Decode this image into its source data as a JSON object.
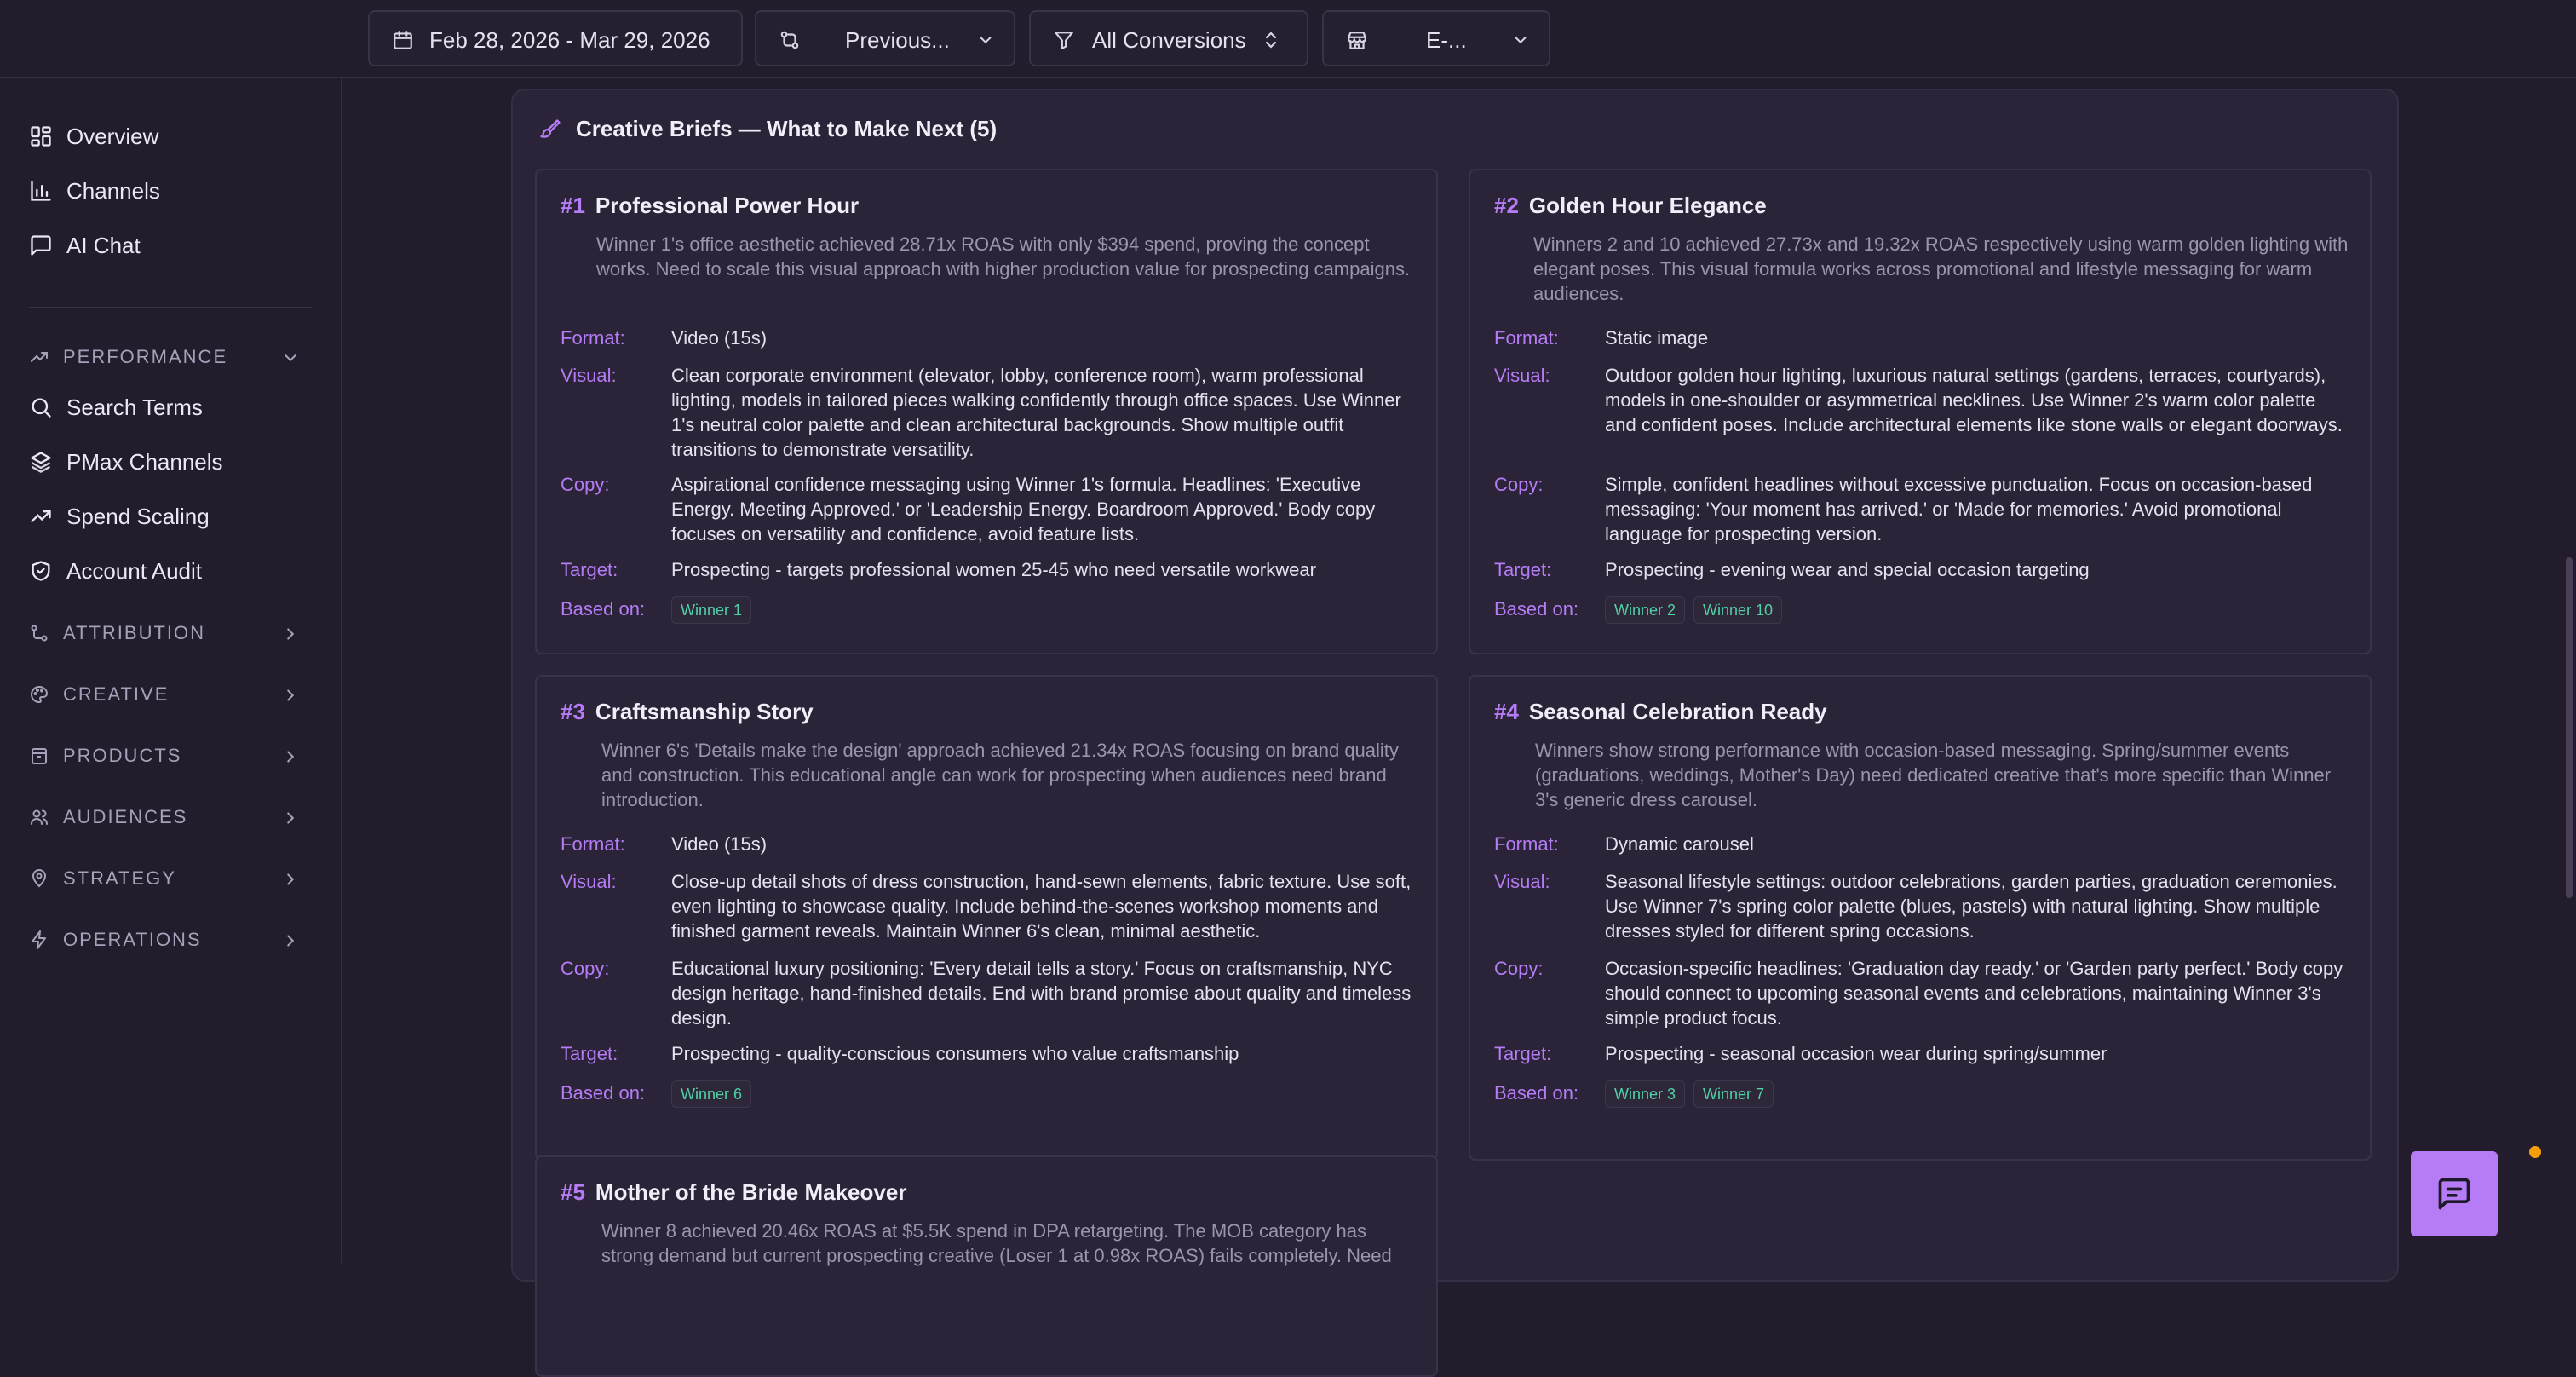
{
  "topbar": {
    "date_range": "Feb 28, 2026 - Mar 29, 2026",
    "compare": "Previous...",
    "conversions": "All Conversions",
    "store": "E-..."
  },
  "sidebar": {
    "main_items": [
      {
        "label": "Overview",
        "icon": "grid-icon"
      },
      {
        "label": "Channels",
        "icon": "bar-chart-icon"
      },
      {
        "label": "AI Chat",
        "icon": "chat-icon"
      }
    ],
    "performance_label": "PERFORMANCE",
    "performance_items": [
      {
        "label": "Search Terms",
        "icon": "search-icon"
      },
      {
        "label": "PMax Channels",
        "icon": "layers-icon"
      },
      {
        "label": "Spend Scaling",
        "icon": "trending-up-icon"
      },
      {
        "label": "Account Audit",
        "icon": "shield-check-icon"
      }
    ],
    "sections": [
      {
        "label": "ATTRIBUTION",
        "icon": "route-icon"
      },
      {
        "label": "CREATIVE",
        "icon": "palette-icon"
      },
      {
        "label": "PRODUCTS",
        "icon": "package-icon"
      },
      {
        "label": "AUDIENCES",
        "icon": "users-icon"
      },
      {
        "label": "STRATEGY",
        "icon": "map-pin-icon"
      },
      {
        "label": "OPERATIONS",
        "icon": "zap-icon"
      }
    ]
  },
  "panel": {
    "title": "Creative Briefs — What to Make Next (5)",
    "labels": {
      "format": "Format:",
      "visual": "Visual:",
      "copy": "Copy:",
      "target": "Target:",
      "based_on": "Based on:"
    },
    "cards": [
      {
        "num": "#1",
        "title": "Professional Power Hour",
        "desc": "Winner 1's office aesthetic achieved 28.71x ROAS with only $394 spend, proving the concept works. Need to scale this visual approach with higher production value for prospecting campaigns.",
        "format": "Video (15s)",
        "visual": "Clean corporate environment (elevator, lobby, conference room), warm professional lighting, models in tailored pieces walking confidently through office spaces. Use Winner 1's neutral color palette and clean architectural backgrounds. Show multiple outfit transitions to demonstrate versatility.",
        "copy": "Aspirational confidence messaging using Winner 1's formula. Headlines: 'Executive Energy. Meeting Approved.' or 'Leadership Energy. Boardroom Approved.' Body copy focuses on versatility and confidence, avoid feature lists.",
        "target": "Prospecting - targets professional women 25-45 who need versatile workwear",
        "based_on": [
          "Winner 1"
        ]
      },
      {
        "num": "#2",
        "title": "Golden Hour Elegance",
        "desc": "Winners 2 and 10 achieved 27.73x and 19.32x ROAS respectively using warm golden lighting with elegant poses. This visual formula works across promotional and lifestyle messaging for warm audiences.",
        "format": "Static image",
        "visual": "Outdoor golden hour lighting, luxurious natural settings (gardens, terraces, courtyards), models in one-shoulder or asymmetrical necklines. Use Winner 2's warm color palette and confident poses. Include architectural elements like stone walls or elegant doorways.",
        "copy": "Simple, confident headlines without excessive punctuation. Focus on occasion-based messaging: 'Your moment has arrived.' or 'Made for memories.' Avoid promotional language for prospecting version.",
        "target": "Prospecting - evening wear and special occasion targeting",
        "based_on": [
          "Winner 2",
          "Winner 10"
        ]
      },
      {
        "num": "#3",
        "title": "Craftsmanship Story",
        "desc": "Winner 6's 'Details make the design' approach achieved 21.34x ROAS focusing on brand quality and construction. This educational angle can work for prospecting when audiences need brand introduction.",
        "format": "Video (15s)",
        "visual": "Close-up detail shots of dress construction, hand-sewn elements, fabric texture. Use soft, even lighting to showcase quality. Include behind-the-scenes workshop moments and finished garment reveals. Maintain Winner 6's clean, minimal aesthetic.",
        "copy": "Educational luxury positioning: 'Every detail tells a story.' Focus on craftsmanship, NYC design heritage, hand-finished details. End with brand promise about quality and timeless design.",
        "target": "Prospecting - quality-conscious consumers who value craftsmanship",
        "based_on": [
          "Winner 6"
        ]
      },
      {
        "num": "#4",
        "title": "Seasonal Celebration Ready",
        "desc": "Winners show strong performance with occasion-based messaging. Spring/summer events (graduations, weddings, Mother's Day) need dedicated creative that's more specific than Winner 3's generic dress carousel.",
        "format": "Dynamic carousel",
        "visual": "Seasonal lifestyle settings: outdoor celebrations, garden parties, graduation ceremonies. Use Winner 7's spring color palette (blues, pastels) with natural lighting. Show multiple dresses styled for different spring occasions.",
        "copy": "Occasion-specific headlines: 'Graduation day ready.' or 'Garden party perfect.' Body copy should connect to upcoming seasonal events and celebrations, maintaining Winner 3's simple product focus.",
        "target": "Prospecting - seasonal occasion wear during spring/summer",
        "based_on": [
          "Winner 3",
          "Winner 7"
        ]
      },
      {
        "num": "#5",
        "title": "Mother of the Bride Makeover",
        "desc": "Winner 8 achieved 20.46x ROAS at $5.5K spend in DPA retargeting. The MOB category has strong demand but current prospecting creative (Loser 1 at 0.98x ROAS) fails completely. Need"
      }
    ]
  }
}
